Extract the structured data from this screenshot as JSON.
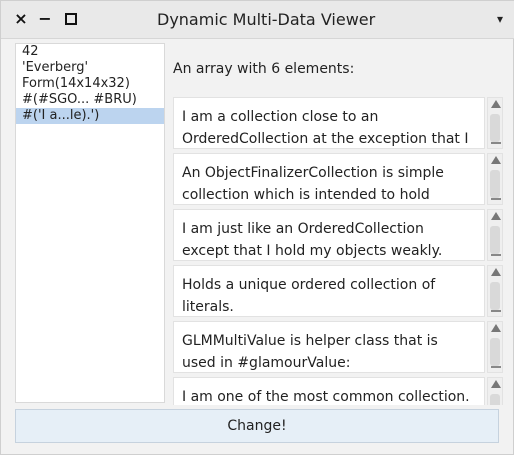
{
  "window": {
    "title": "Dynamic Multi-Data Viewer",
    "controls": {
      "close": "×",
      "minimize": "−",
      "menu": "▾"
    }
  },
  "left_list": {
    "items": [
      "42",
      "'Everberg'",
      "Form(14x14x32)",
      "#(#SGO... #BRU)",
      "#('I a...le).')"
    ],
    "selected_index": 4
  },
  "right_pane": {
    "header": "An array with 6 elements:",
    "items": [
      {
        "text": "I am a collection close to an OrderedCollection at the exception that I"
      },
      {
        "text": "An ObjectFinalizerCollection is simple collection which is intended to hold"
      },
      {
        "text": "I am just like an OrderedCollection except that I hold my objects weakly."
      },
      {
        "text": "Holds a unique ordered collection of literals."
      },
      {
        "text": "GLMMultiValue is helper class that is used in #glamourValue:"
      },
      {
        "text": "I am one of the most common collection. I can grow, and elements can be added"
      }
    ]
  },
  "footer": {
    "button_label": "Change!"
  },
  "colors": {
    "selection": "#bcd4ef",
    "button_bg": "#e6eff7"
  }
}
